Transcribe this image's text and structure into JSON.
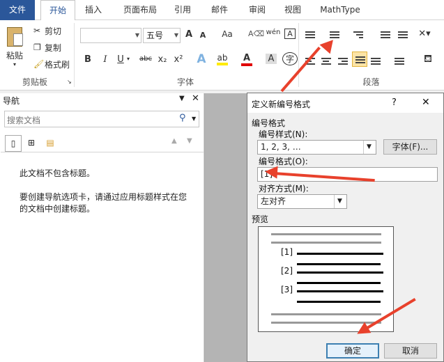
{
  "tabs": [
    "文件",
    "开始",
    "插入",
    "页面布局",
    "引用",
    "邮件",
    "审阅",
    "视图",
    "MathType"
  ],
  "clipboard": {
    "paste": "粘贴",
    "cut": "剪切",
    "copy": "复制",
    "format_painter": "格式刷",
    "group_label": "剪贴板"
  },
  "font": {
    "size": "五号",
    "group_label": "字体",
    "bold": "B",
    "italic": "I",
    "underline": "U",
    "strike": "abc",
    "sub": "x₂",
    "sup": "x²",
    "grow": "A",
    "shrink": "A",
    "wen": "wén"
  },
  "paragraph": {
    "group_label": "段落"
  },
  "nav": {
    "title": "导航",
    "search_placeholder": "搜索文档",
    "empty_title": "此文档不包含标题。",
    "empty_help": "要创建导航选项卡，请通过应用标题样式在您的文档中创建标题。"
  },
  "dialog": {
    "title": "定义新编号格式",
    "help": "?",
    "close": "✕",
    "section_format": "编号格式",
    "style_label": "编号样式(N):",
    "style_value": "1, 2, 3, …",
    "font_button": "字体(F)...",
    "format_label": "编号格式(O):",
    "format_value": "[1]",
    "align_label": "对齐方式(M):",
    "align_value": "左对齐",
    "preview_label": "预览",
    "preview_items": [
      "[1]",
      "[2]",
      "[3]"
    ],
    "ok": "确定",
    "cancel": "取消"
  },
  "colors": {
    "file_tab": "#2b579a",
    "accent": "#e8412c",
    "ok_border": "#3c7fb1"
  }
}
